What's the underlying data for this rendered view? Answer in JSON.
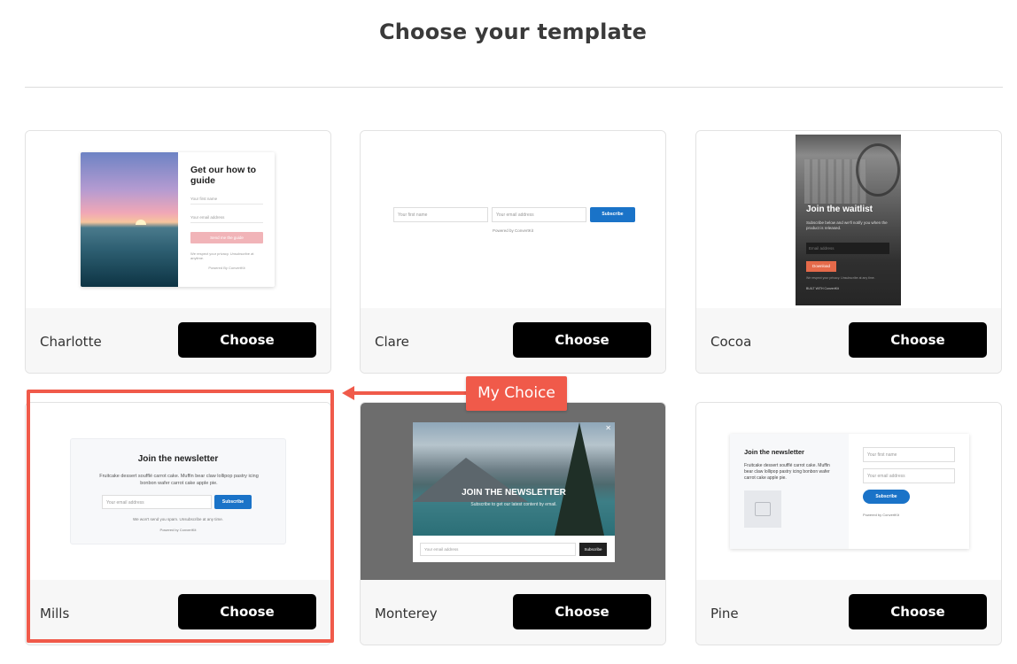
{
  "page": {
    "title": "Choose your template"
  },
  "templates": [
    {
      "name": "Charlotte",
      "choose_label": "Choose",
      "preview": {
        "heading": "Get our how to guide",
        "first_name_placeholder": "Your first name",
        "email_placeholder": "Your email address",
        "button": "Send me the guide",
        "privacy": "We respect your privacy. Unsubscribe at anytime.",
        "powered": "Powered By ConvertKit"
      }
    },
    {
      "name": "Clare",
      "choose_label": "Choose",
      "preview": {
        "first_name_placeholder": "Your first name",
        "email_placeholder": "Your email address",
        "button": "Subscribe",
        "powered": "Powered by ConvertKit"
      }
    },
    {
      "name": "Cocoa",
      "choose_label": "Choose",
      "preview": {
        "heading": "Join the waitlist",
        "subtext": "Subscribe below and we'll notify you when the product is released.",
        "email_placeholder": "Email address",
        "button": "Download",
        "privacy": "We respect your privacy. Unsubscribe at any time.",
        "powered": "BUILT WITH ConvertKit"
      }
    },
    {
      "name": "Mills",
      "choose_label": "Choose",
      "preview": {
        "heading": "Join the newsletter",
        "text": "Fruitcake dessert soufflé carrot cake. Muffin bear claw lollipop pastry icing bonbon wafer carrot cake apple pie.",
        "email_placeholder": "Your email address",
        "button": "Subscribe",
        "note": "We won't send you spam. Unsubscribe at any time.",
        "powered": "Powered by ConvertKit"
      }
    },
    {
      "name": "Monterey",
      "choose_label": "Choose",
      "preview": {
        "heading": "JOIN THE NEWSLETTER",
        "subtext": "Subscribe to get our latest content by email.",
        "email_placeholder": "Your email address",
        "button": "Subscribe"
      }
    },
    {
      "name": "Pine",
      "choose_label": "Choose",
      "preview": {
        "heading": "Join the newsletter",
        "text": "Fruitcake dessert soufflé carrot cake. Muffin bear claw lollipop pastry icing bonbon wafer carrot cake apple pie.",
        "first_name_placeholder": "Your first name",
        "email_placeholder": "Your email address",
        "button": "Subscribe",
        "powered": "Powered by ConvertKit"
      }
    }
  ],
  "annotation": {
    "label": "My Choice",
    "color": "#f05a4a"
  }
}
